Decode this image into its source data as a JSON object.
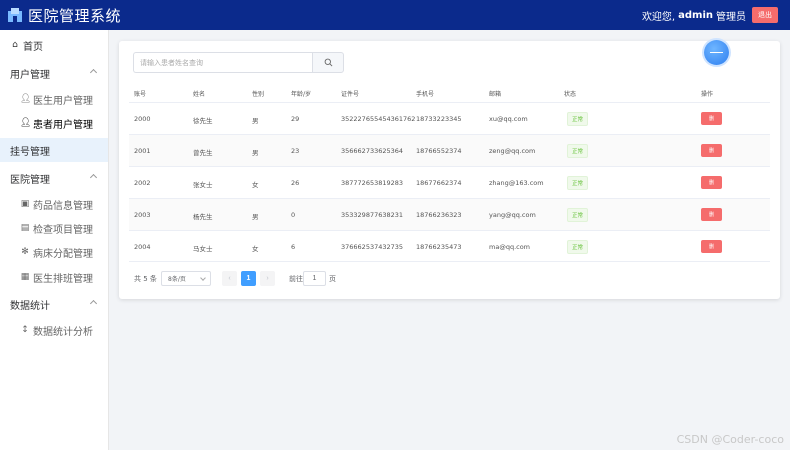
{
  "header": {
    "title": "医院管理系统",
    "welcome": "欢迎您,",
    "username": "admin",
    "role": "管理员",
    "logout_label": "退出"
  },
  "sidebar": {
    "home": "首页",
    "group_user": "用户管理",
    "item_doctor_user": "医生用户管理",
    "item_patient_user": "患者用户管理",
    "group_register": "挂号管理",
    "group_hospital": "医院管理",
    "item_drug": "药品信息管理",
    "item_exam": "检查项目管理",
    "item_bed": "病床分配管理",
    "item_schedule": "医生排班管理",
    "group_stats": "数据统计",
    "item_stats": "数据统计分析"
  },
  "search": {
    "placeholder": "请输入患者姓名查询"
  },
  "table": {
    "headers": [
      "账号",
      "姓名",
      "性别",
      "年龄/岁",
      "证件号",
      "手机号",
      "邮箱",
      "状态",
      "操作"
    ],
    "rows": [
      {
        "id": "2000",
        "name": "徐先生",
        "gender": "男",
        "age": "29",
        "idcard": "352227655454361762",
        "phone": "18733223345",
        "email": "xu@qq.com",
        "status": "正常",
        "action": "删"
      },
      {
        "id": "2001",
        "name": "曾先生",
        "gender": "男",
        "age": "23",
        "idcard": "356662733625364",
        "phone": "18766552374",
        "email": "zeng@qq.com",
        "status": "正常",
        "action": "删"
      },
      {
        "id": "2002",
        "name": "张女士",
        "gender": "女",
        "age": "26",
        "idcard": "387772653819283",
        "phone": "18677662374",
        "email": "zhang@163.com",
        "status": "正常",
        "action": "删"
      },
      {
        "id": "2003",
        "name": "杨先生",
        "gender": "男",
        "age": "0",
        "idcard": "353329877638231",
        "phone": "18766236323",
        "email": "yang@qq.com",
        "status": "正常",
        "action": "删"
      },
      {
        "id": "2004",
        "name": "马女士",
        "gender": "女",
        "age": "6",
        "idcard": "376662537432735",
        "phone": "18766235473",
        "email": "ma@qq.com",
        "status": "正常",
        "action": "删"
      }
    ]
  },
  "pagination": {
    "total": "共 5 条",
    "page_size": "8条/页",
    "prev": "‹",
    "current": "1",
    "next": "›",
    "goto_label": "前往",
    "goto_value": "1",
    "page_suffix": "页"
  },
  "watermark": "CSDN @Coder-coco",
  "colors": {
    "header_bg": "#0b2a8c",
    "danger": "#f56c6c",
    "primary": "#409eff",
    "success": "#67c23a"
  }
}
